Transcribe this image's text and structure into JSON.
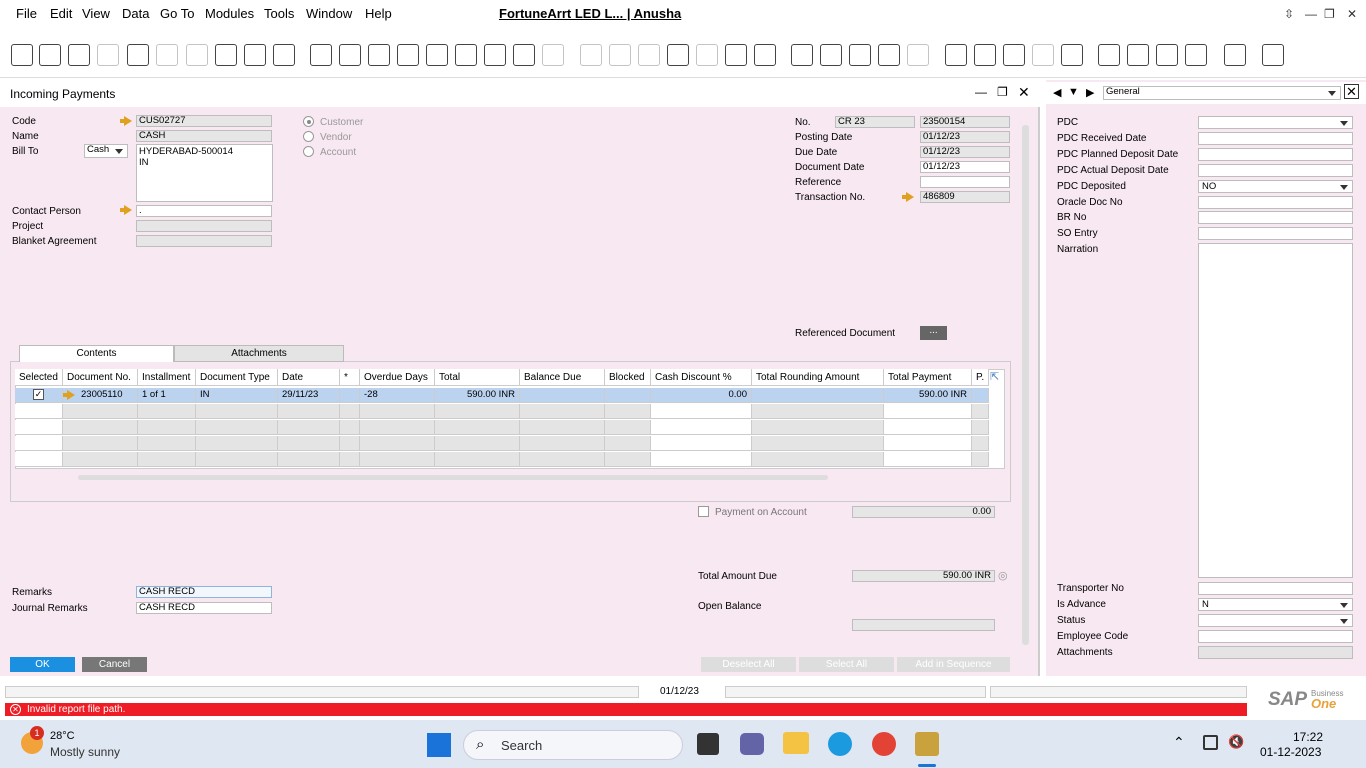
{
  "menu": [
    "File",
    "Edit",
    "View",
    "Data",
    "Go To",
    "Modules",
    "Tools",
    "Window",
    "Help"
  ],
  "app_title": "FortuneArrt LED L... | Anusha",
  "window": {
    "title": "Incoming Payments"
  },
  "left_fields": {
    "code_label": "Code",
    "code_value": "CUS02727",
    "name_label": "Name",
    "name_value": "CASH",
    "billto_label": "Bill To",
    "billto_type": "Cash",
    "billto_line1": "HYDERABAD-500014",
    "billto_line2": "IN",
    "contact_label": "Contact Person",
    "contact_value": ".",
    "project_label": "Project",
    "project_value": "",
    "blanket_label": "Blanket Agreement",
    "blanket_value": ""
  },
  "radios": {
    "customer": "Customer",
    "vendor": "Vendor",
    "account": "Account"
  },
  "right_fields": {
    "no_label": "No.",
    "no_series": "CR 23",
    "no_value": "23500154",
    "posting_label": "Posting Date",
    "posting_value": "01/12/23",
    "due_label": "Due Date",
    "due_value": "01/12/23",
    "docdate_label": "Document Date",
    "docdate_value": "01/12/23",
    "ref_label": "Reference",
    "ref_value": "",
    "trans_label": "Transaction No.",
    "trans_value": "486809",
    "refdoc_label": "Referenced Document",
    "refdoc_btn": "..."
  },
  "tabs": {
    "contents": "Contents",
    "attachments": "Attachments"
  },
  "table": {
    "headers": [
      "Selected",
      "Document No.",
      "Installment",
      "Document Type",
      "Date",
      "*",
      "Overdue Days",
      "Total",
      "Balance Due",
      "Blocked",
      "Cash Discount %",
      "Total Rounding Amount",
      "Total Payment",
      "P."
    ],
    "row": {
      "doc_no": "23005110",
      "installment": "1 of 1",
      "doc_type": "IN",
      "date": "29/11/23",
      "overdue": "-28",
      "total": "590.00 INR",
      "cash_discount": "0.00",
      "total_payment": "590.00 INR"
    }
  },
  "payment_on_account": {
    "label": "Payment on Account",
    "value": "0.00"
  },
  "total_amount_due": {
    "label": "Total Amount Due",
    "value": "590.00 INR"
  },
  "open_balance": {
    "label": "Open Balance",
    "value": ""
  },
  "remarks": {
    "label": "Remarks",
    "value": "CASH RECD"
  },
  "journal_remarks": {
    "label": "Journal Remarks",
    "value": "CASH RECD"
  },
  "buttons": {
    "ok": "OK",
    "cancel": "Cancel",
    "deselect_all": "Deselect All",
    "select_all": "Select All",
    "add_in_sequence": "Add in Sequence"
  },
  "side_panel": {
    "dropdown": "General",
    "fields": [
      {
        "label": "PDC",
        "value": ""
      },
      {
        "label": "PDC Received Date",
        "value": ""
      },
      {
        "label": "PDC Planned Deposit Date",
        "value": ""
      },
      {
        "label": "PDC Actual Deposit Date",
        "value": ""
      },
      {
        "label": "PDC Deposited",
        "value": "NO"
      },
      {
        "label": "Oracle Doc No",
        "value": ""
      },
      {
        "label": "BR No",
        "value": ""
      },
      {
        "label": "SO Entry",
        "value": ""
      },
      {
        "label": "Narration",
        "value": ""
      },
      {
        "label": "Transporter No",
        "value": ""
      },
      {
        "label": "Is Advance",
        "value": "N"
      },
      {
        "label": "Status",
        "value": ""
      },
      {
        "label": "Employee Code",
        "value": ""
      },
      {
        "label": "Attachments",
        "value": ""
      }
    ]
  },
  "status": {
    "date": "01/12/23",
    "error": "Invalid report file path.",
    "brand": "SAP",
    "brand_sub1": "Business",
    "brand_sub2": "One"
  },
  "taskbar": {
    "temp": "28°C",
    "weather": "Mostly sunny",
    "badge": "1",
    "search": "Search",
    "time": "17:22",
    "date": "01-12-2023"
  },
  "colors": {
    "pink_bg": "#f8e8f1",
    "ok_blue": "#1b8fe0",
    "cancel_gray": "#777777",
    "error_red": "#ee1c24",
    "selected_row": "#bcd3f0"
  }
}
